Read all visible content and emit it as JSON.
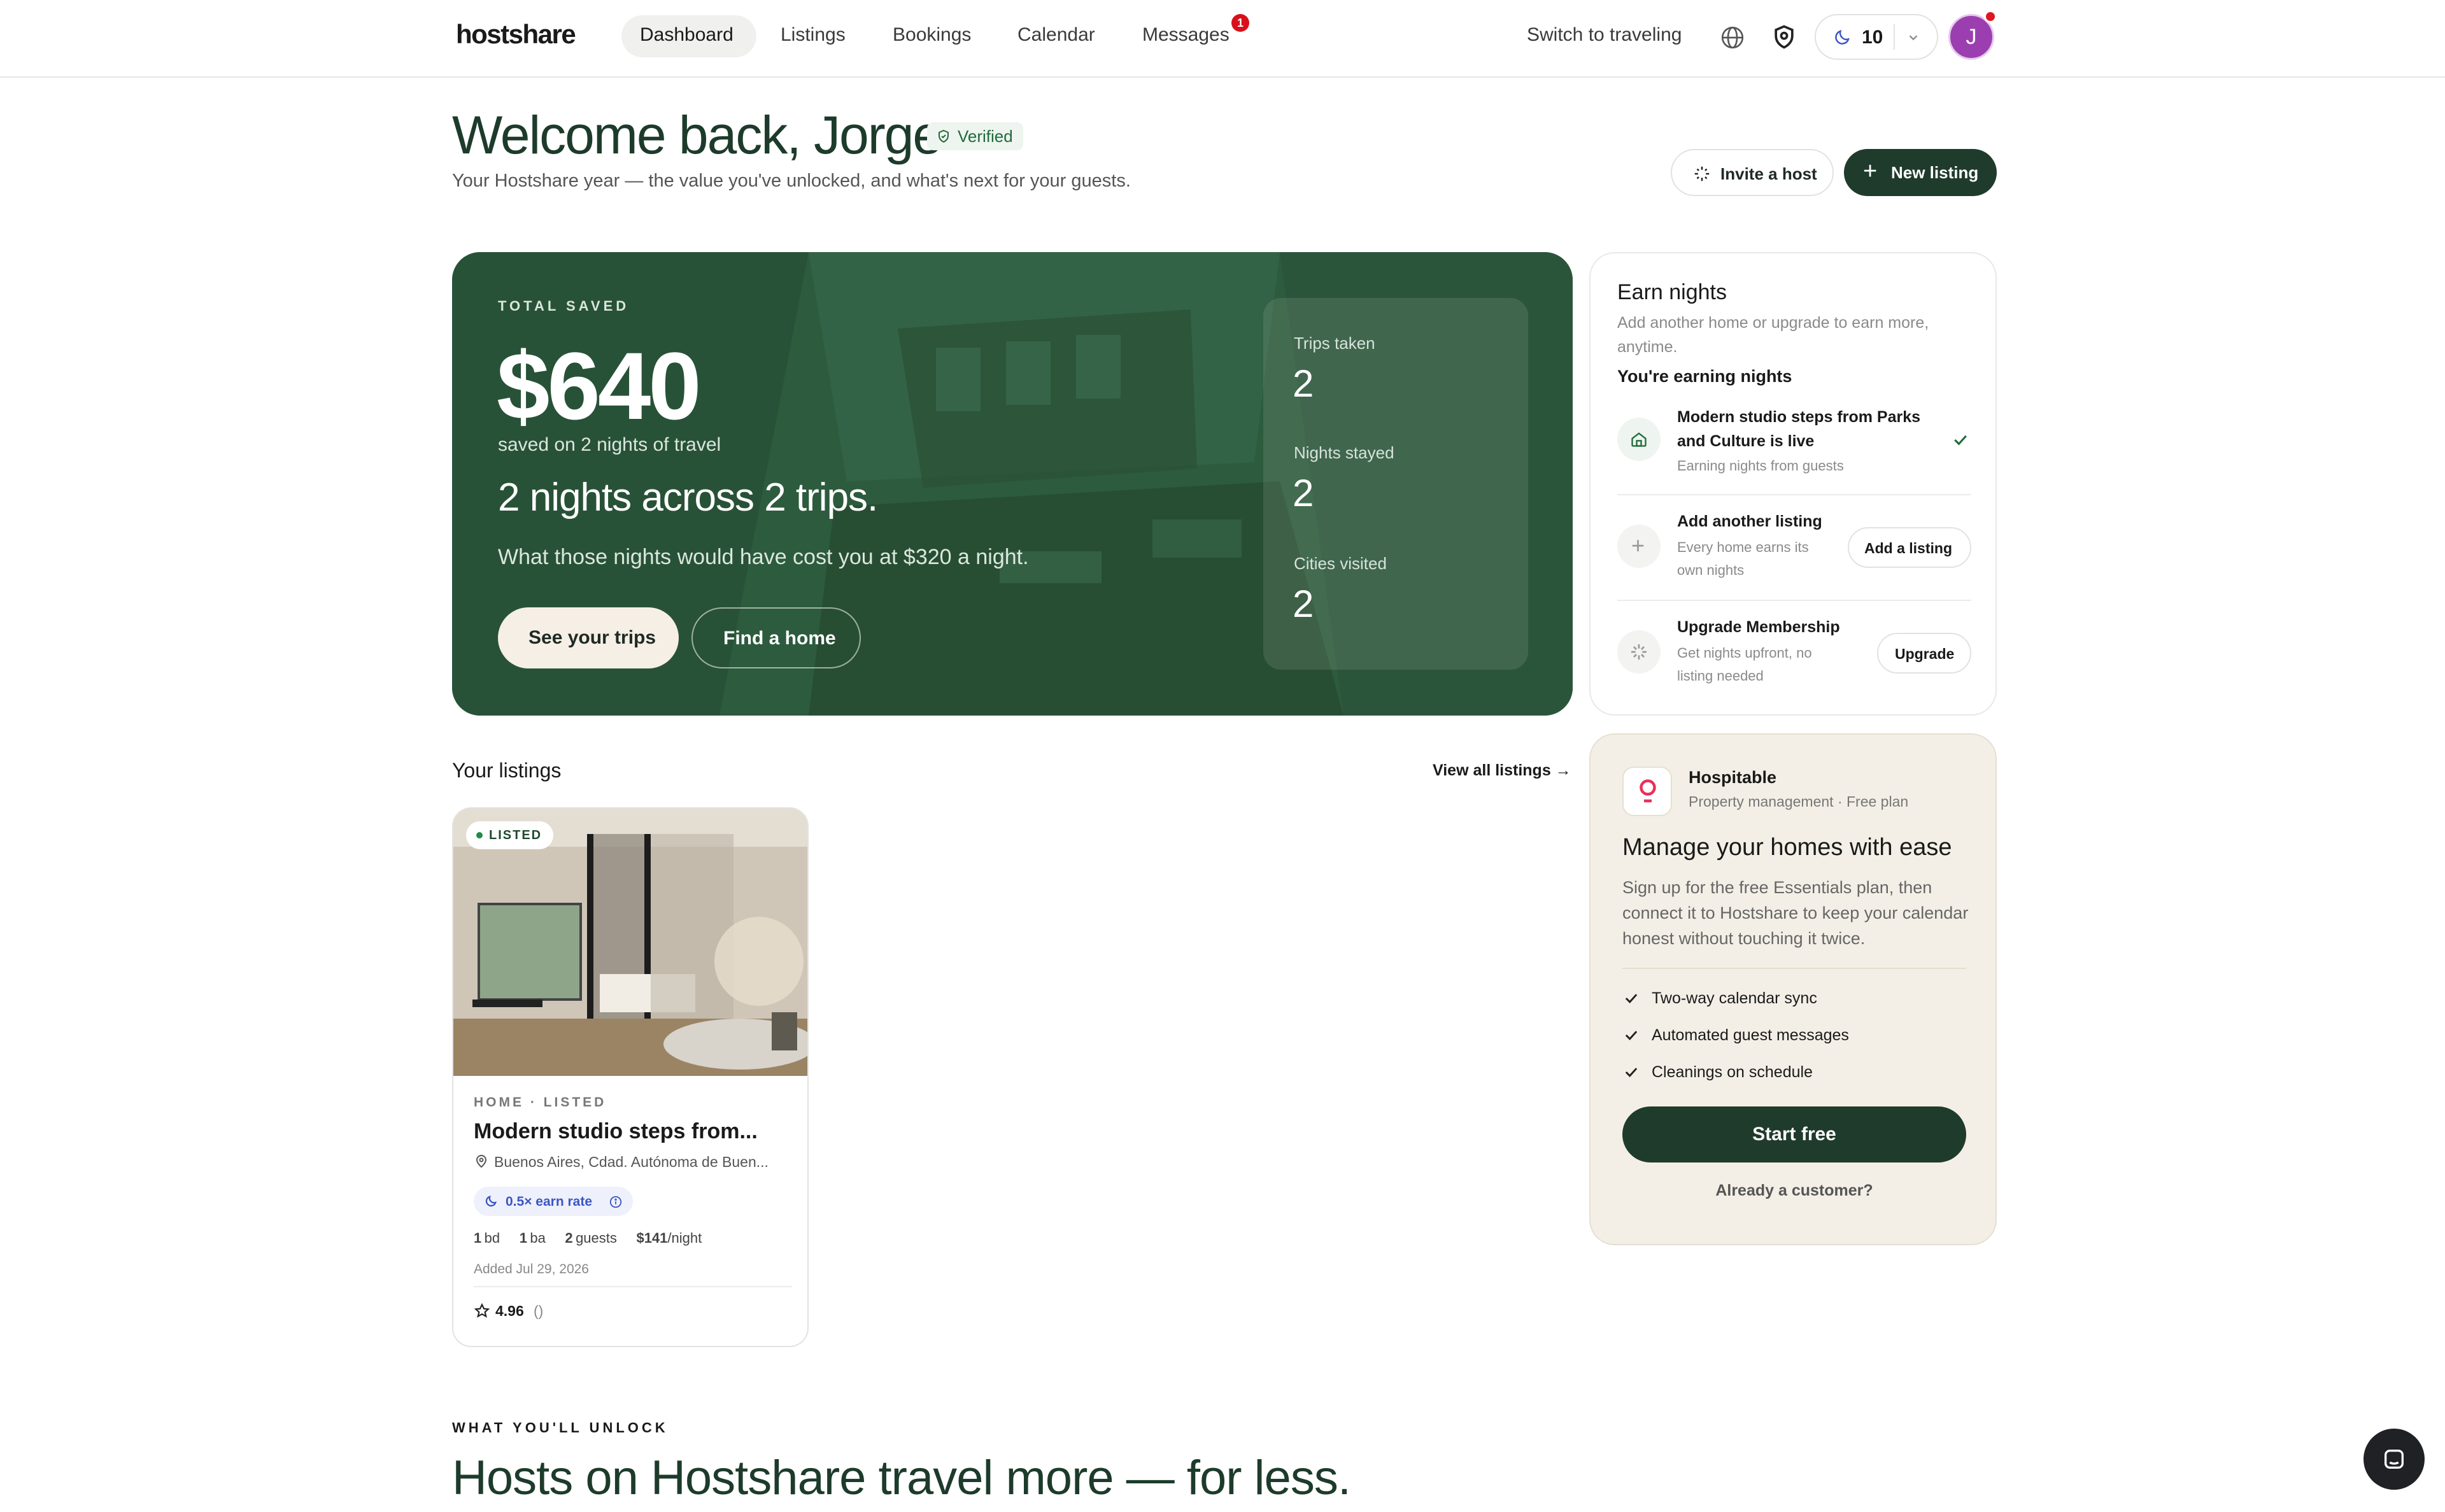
{
  "nav": {
    "logo": "hostshare",
    "links": [
      "Dashboard",
      "Listings",
      "Bookings",
      "Calendar",
      "Messages"
    ],
    "messages_badge": "1",
    "switch_label": "Switch to traveling",
    "nights_count": "10",
    "avatar_initial": "J"
  },
  "header": {
    "title": "Welcome back, Jorge",
    "verified": "Verified",
    "subtitle": "Your Hostshare year — the value you've unlocked, and what's next for your guests.",
    "invite_label": "Invite a host",
    "new_listing_label": "New listing"
  },
  "hero": {
    "eyebrow": "TOTAL SAVED",
    "amount": "$640",
    "saved_note": "saved on 2 nights of travel",
    "headline": "2 nights across 2 trips.",
    "description": "What those nights would have cost you at $320 a night.",
    "primary_button": "See your trips",
    "secondary_button": "Find a home",
    "stats": [
      {
        "label": "Trips taken",
        "value": "2"
      },
      {
        "label": "Nights stayed",
        "value": "2"
      },
      {
        "label": "Cities visited",
        "value": "2"
      }
    ]
  },
  "earn": {
    "title": "Earn nights",
    "subtitle": "Add another home or upgrade to earn more, anytime.",
    "status": "You're earning nights",
    "rows": [
      {
        "title": "Modern studio steps from Parks and Culture is live",
        "sub": "Earning nights from guests",
        "button": ""
      },
      {
        "title": "Add another listing",
        "sub": "Every home earns its own nights",
        "button": "Add a listing"
      },
      {
        "title": "Upgrade Membership",
        "sub": "Get nights upfront, no listing needed",
        "button": "Upgrade"
      }
    ]
  },
  "hospitable": {
    "name": "Hospitable",
    "meta": "Property management · Free plan",
    "title": "Manage your homes with ease",
    "body": "Sign up for the free Essentials plan, then connect it to Hostshare to keep your calendar honest without touching it twice.",
    "features": [
      "Two-way calendar sync",
      "Automated guest messages",
      "Cleanings on schedule"
    ],
    "cta": "Start free",
    "secondary": "Already a customer?"
  },
  "listings": {
    "section_title": "Your listings",
    "view_all": "View all listings →",
    "card": {
      "badge": "LISTED",
      "eyebrow": "HOME · LISTED",
      "title": "Modern studio steps from...",
      "location": "Buenos Aires, Cdad. Autónoma de Buen...",
      "earn_rate": "0.5× earn rate",
      "bd": "1",
      "bd_unit": "bd",
      "ba": "1",
      "ba_unit": "ba",
      "guests": "2",
      "guests_unit": "guests",
      "price": "$141",
      "price_unit": "/night",
      "added": "Added Jul 29, 2026",
      "rating": "4.96",
      "reviews": "()"
    }
  },
  "unlock": {
    "eyebrow": "WHAT YOU'LL UNLOCK",
    "headline": "Hosts on Hostshare travel more — for less."
  }
}
